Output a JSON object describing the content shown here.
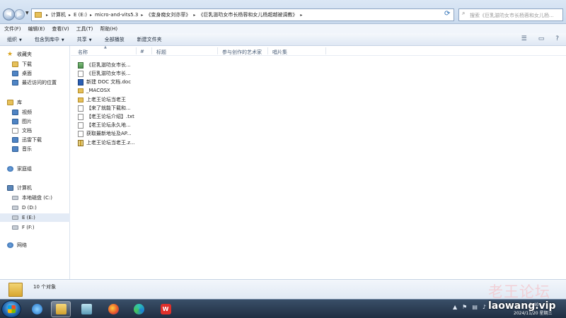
{
  "addressbar": {
    "crumbs": [
      "计算机",
      "E (E:)",
      "micro-and-vits5.3",
      "《变身痴女刘亦菲》",
      "《巨乳滋叻女市长杨蓉和女儿杨超越被调教》"
    ],
    "search_placeholder": "搜索《巨乳滋叻女市长杨蓉和女儿杨..."
  },
  "menubar": {
    "items": [
      "文件(F)",
      "编辑(E)",
      "查看(V)",
      "工具(T)",
      "帮助(H)"
    ]
  },
  "toolbar": {
    "organize": "组织",
    "include_library": "包含到库中",
    "share": "共享",
    "play_all": "全部播放",
    "new_folder": "新建文件夹"
  },
  "navpane": {
    "favorites": "收藏夹",
    "downloads": "下载",
    "desktop": "桌面",
    "recent": "最近访问的位置",
    "libraries": "库",
    "videos": "视频",
    "pictures": "图片",
    "documents": "文档",
    "xunlei": "迅雷下载",
    "music": "音乐",
    "homegroup": "家庭组",
    "computer": "计算机",
    "drive_c": "本地磁盘 (C:)",
    "drive_d": "D (D:)",
    "drive_e": "E (E:)",
    "drive_f": "F (F:)",
    "network": "网络"
  },
  "columns": {
    "name": "名称",
    "number": "#",
    "title": "标题",
    "artists": "参与创作的艺术家",
    "album": "唱片集"
  },
  "files": [
    {
      "name": "《巨乳滋叻女市长...",
      "icon": "image-file-icon"
    },
    {
      "name": "《巨乳滋叻女市长...",
      "icon": "document-file-icon"
    },
    {
      "name": "新建 DOC 文档.doc",
      "icon": "word-file-icon"
    },
    {
      "name": "_MACOSX",
      "icon": "folder-icon"
    },
    {
      "name": "上老王论坛当老王",
      "icon": "folder-icon"
    },
    {
      "name": "【来了就能下载和...",
      "icon": "document-file-icon"
    },
    {
      "name": "【老王论坛介绍】.txt",
      "icon": "document-file-icon"
    },
    {
      "name": "【老王论坛永久地...",
      "icon": "document-file-icon"
    },
    {
      "name": "获取最新地址及AP...",
      "icon": "document-file-icon"
    },
    {
      "name": "上老王论坛当老王.z...",
      "icon": "zip-file-icon"
    }
  ],
  "details": {
    "item_count": "10 个对象"
  },
  "watermark": {
    "title": "老王论坛",
    "url": "laowang.vip"
  },
  "taskbar": {
    "time": "8:40",
    "date": "2024/11/20 星期三"
  }
}
